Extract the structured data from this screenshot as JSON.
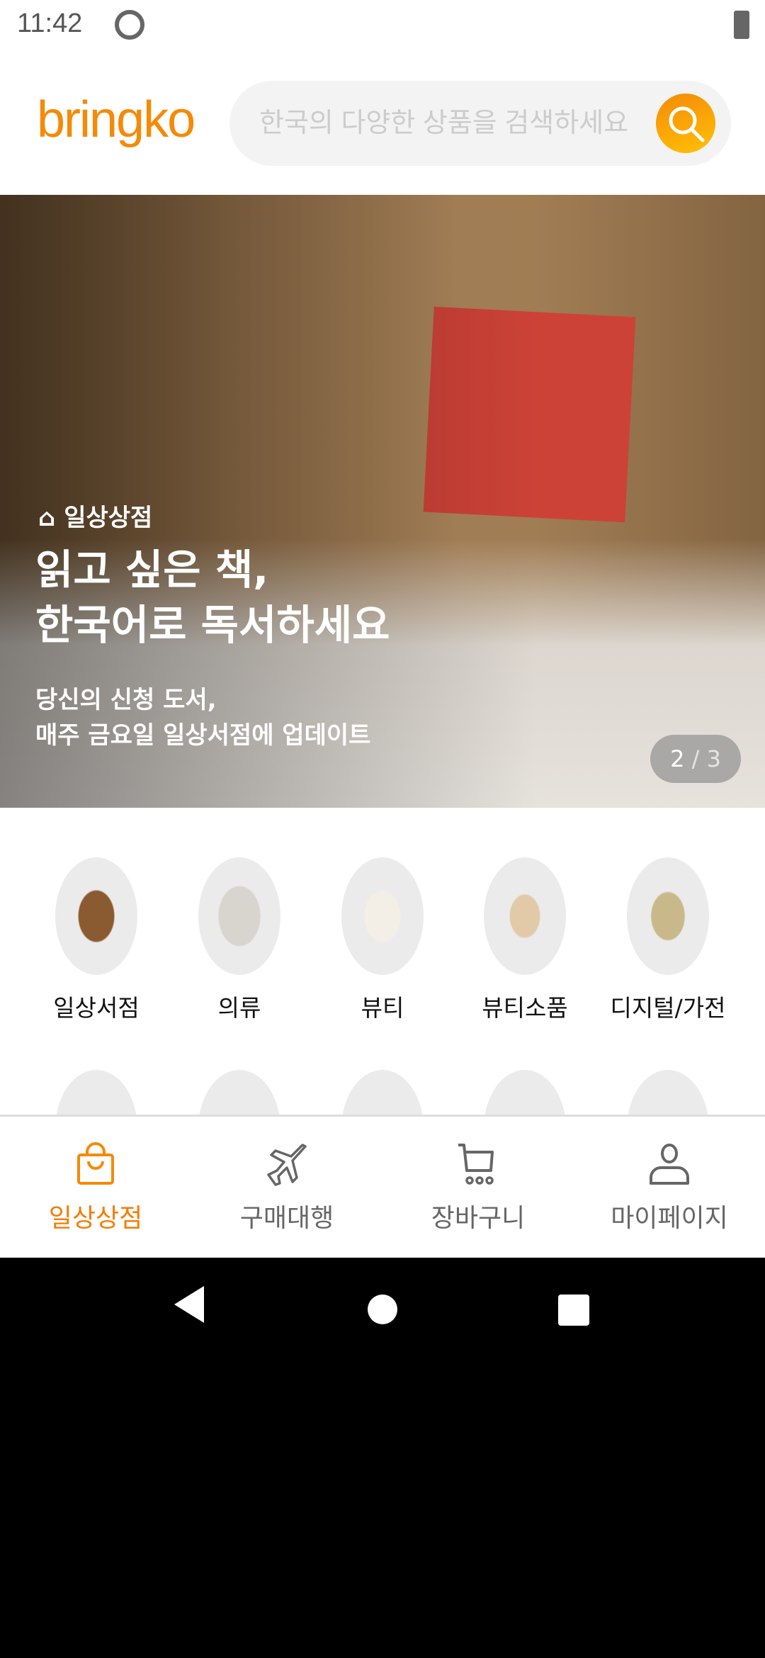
{
  "status_bar": {
    "time": "11:42"
  },
  "header": {
    "logo": "bringko",
    "search_placeholder": "한국의 다양한 상품을 검색하세요"
  },
  "banner": {
    "tag": "일상상점",
    "title_line1": "읽고 싶은 책,",
    "title_line2": "한국어로 독서하세요",
    "subtitle_line1": "당신의 신청 도서,",
    "subtitle_line2": "매주 금요일 일상서점에 업데이트",
    "page_current": "2",
    "page_total": "/ 3"
  },
  "categories": [
    {
      "label": "일상서점"
    },
    {
      "label": "의류"
    },
    {
      "label": "뷰티"
    },
    {
      "label": "뷰티소품"
    },
    {
      "label": "디지털/가전"
    }
  ],
  "bottom_nav": {
    "items": [
      {
        "label": "일상상점",
        "icon": "shopping-bag-icon",
        "active": true
      },
      {
        "label": "구매대행",
        "icon": "airplane-icon"
      },
      {
        "label": "장바구니",
        "icon": "cart-icon"
      },
      {
        "label": "마이페이지",
        "icon": "person-icon"
      }
    ]
  },
  "colors": {
    "brand": "#f58a07",
    "active": "#f57c00",
    "inactive": "#666666"
  }
}
